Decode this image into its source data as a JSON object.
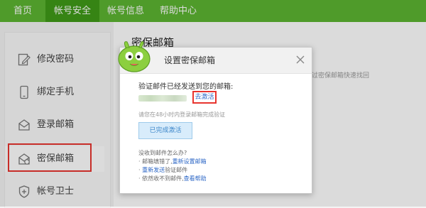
{
  "nav": {
    "tabs": [
      {
        "label": "首页"
      },
      {
        "label": "帐号安全"
      },
      {
        "label": "帐号信息"
      },
      {
        "label": "帮助中心"
      }
    ]
  },
  "sidebar": {
    "items": [
      {
        "label": "修改密码",
        "icon": "edit-icon"
      },
      {
        "label": "绑定手机",
        "icon": "phone-icon"
      },
      {
        "label": "登录邮箱",
        "icon": "mail-icon"
      },
      {
        "label": "密保邮箱",
        "icon": "secure-mail-icon"
      },
      {
        "label": "帐号卫士",
        "icon": "shield-icon"
      }
    ]
  },
  "main": {
    "title": "密保邮箱",
    "sub": "通过密保邮箱快速找回"
  },
  "modal": {
    "title": "设置密保邮箱",
    "sent_text": "验证邮件已经发送到您的邮箱:",
    "activate_label": "去激活",
    "hint": "请您在48小时内登录邮箱完成验证",
    "done_label": "已完成激活",
    "not_received": "没收到邮件怎么办?",
    "line1_prefix": "· 邮箱填错了,",
    "line1_link": "重新设置邮箱",
    "line2_link": "重新发送",
    "line2_suffix": "验证邮件",
    "line3_prefix": "· 依然收不到邮件,",
    "line3_link": "查看帮助"
  },
  "colors": {
    "brand_green": "#5cb531",
    "active_green": "#3f9a18",
    "highlight_red": "#e8352f",
    "link_blue": "#2b66c6"
  }
}
